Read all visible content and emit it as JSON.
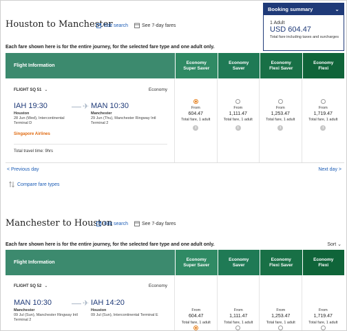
{
  "summary": {
    "title": "Booking summary",
    "adults": "1 Adult",
    "price": "USD 604.47",
    "note": "Total fare including taxes and surcharges"
  },
  "outbound": {
    "title": "Houston to Manchester",
    "edit": "Edit search",
    "fares7": "See 7-day fares",
    "note": "Each fare shown here is for the entire journey, for the selected fare type and one adult only.",
    "header_info": "Flight Information",
    "columns": [
      "Economy\nSuper Saver",
      "Economy\nSaver",
      "Economy\nFlexi Saver",
      "Economy\nFlexi"
    ],
    "flight_no": "FLIGHT SQ 51",
    "cabin": "Economy",
    "dep_time": "IAH 19:30",
    "dep_city": "Houston",
    "dep_detail": "28 Jun (Wed), Intercontinental Terminal D",
    "arr_time": "MAN 10:30",
    "arr_city": "Manchester",
    "arr_detail": "29 Jun (Thu), Manchester Ringway Intl Terminal 2",
    "airline": "Singapore Airlines",
    "travel_time": "Total travel time: 9hrs",
    "fares": [
      {
        "from": "From",
        "price": "604.47",
        "sub": "Total fare, 1 adult"
      },
      {
        "from": "From",
        "price": "1,111.47",
        "sub": "Total fare, 1 adult"
      },
      {
        "from": "From",
        "price": "1,253.47",
        "sub": "Total fare, 1 adult"
      },
      {
        "from": "From",
        "price": "1,719.47",
        "sub": "Total fare, 1 adult"
      }
    ],
    "prev": "< Previous day",
    "next": "Next day >",
    "compare": "Compare fare types"
  },
  "inbound": {
    "title": "Manchester to Houston",
    "edit": "Edit search",
    "fares7": "See 7-day fares",
    "note": "Each fare shown here is for the entire journey, for the selected fare type and one adult only.",
    "sort": "Sort",
    "header_info": "Flight Information",
    "columns": [
      "Economy\nSuper Saver",
      "Economy\nSaver",
      "Economy\nFlexi Saver",
      "Economy\nFlexi"
    ],
    "flight_no": "FLIGHT SQ 52",
    "cabin": "Economy",
    "dep_time": "MAN 10:30",
    "dep_city": "Manchester",
    "dep_detail": "09 Jul (Sun), Manchester Ringway Intl Terminal 2",
    "arr_time": "IAH 14:20",
    "arr_city": "Houston",
    "arr_detail": "09 Jul (Sun), Intercontinental Terminal E",
    "fares": [
      {
        "from": "From",
        "price": "604.47",
        "sub": "Total fare, 1 adult"
      },
      {
        "from": "From",
        "price": "1,111.47",
        "sub": "Total fare, 1 adult"
      },
      {
        "from": "From",
        "price": "1,253.47",
        "sub": "Total fare, 1 adult"
      },
      {
        "from": "From",
        "price": "1,719.47",
        "sub": "Total fare, 1 adult"
      }
    ]
  },
  "colors": {
    "accent_orange": "#e6801d",
    "brand_navy": "#1f3a78",
    "header_green": "#3c8a6e"
  }
}
